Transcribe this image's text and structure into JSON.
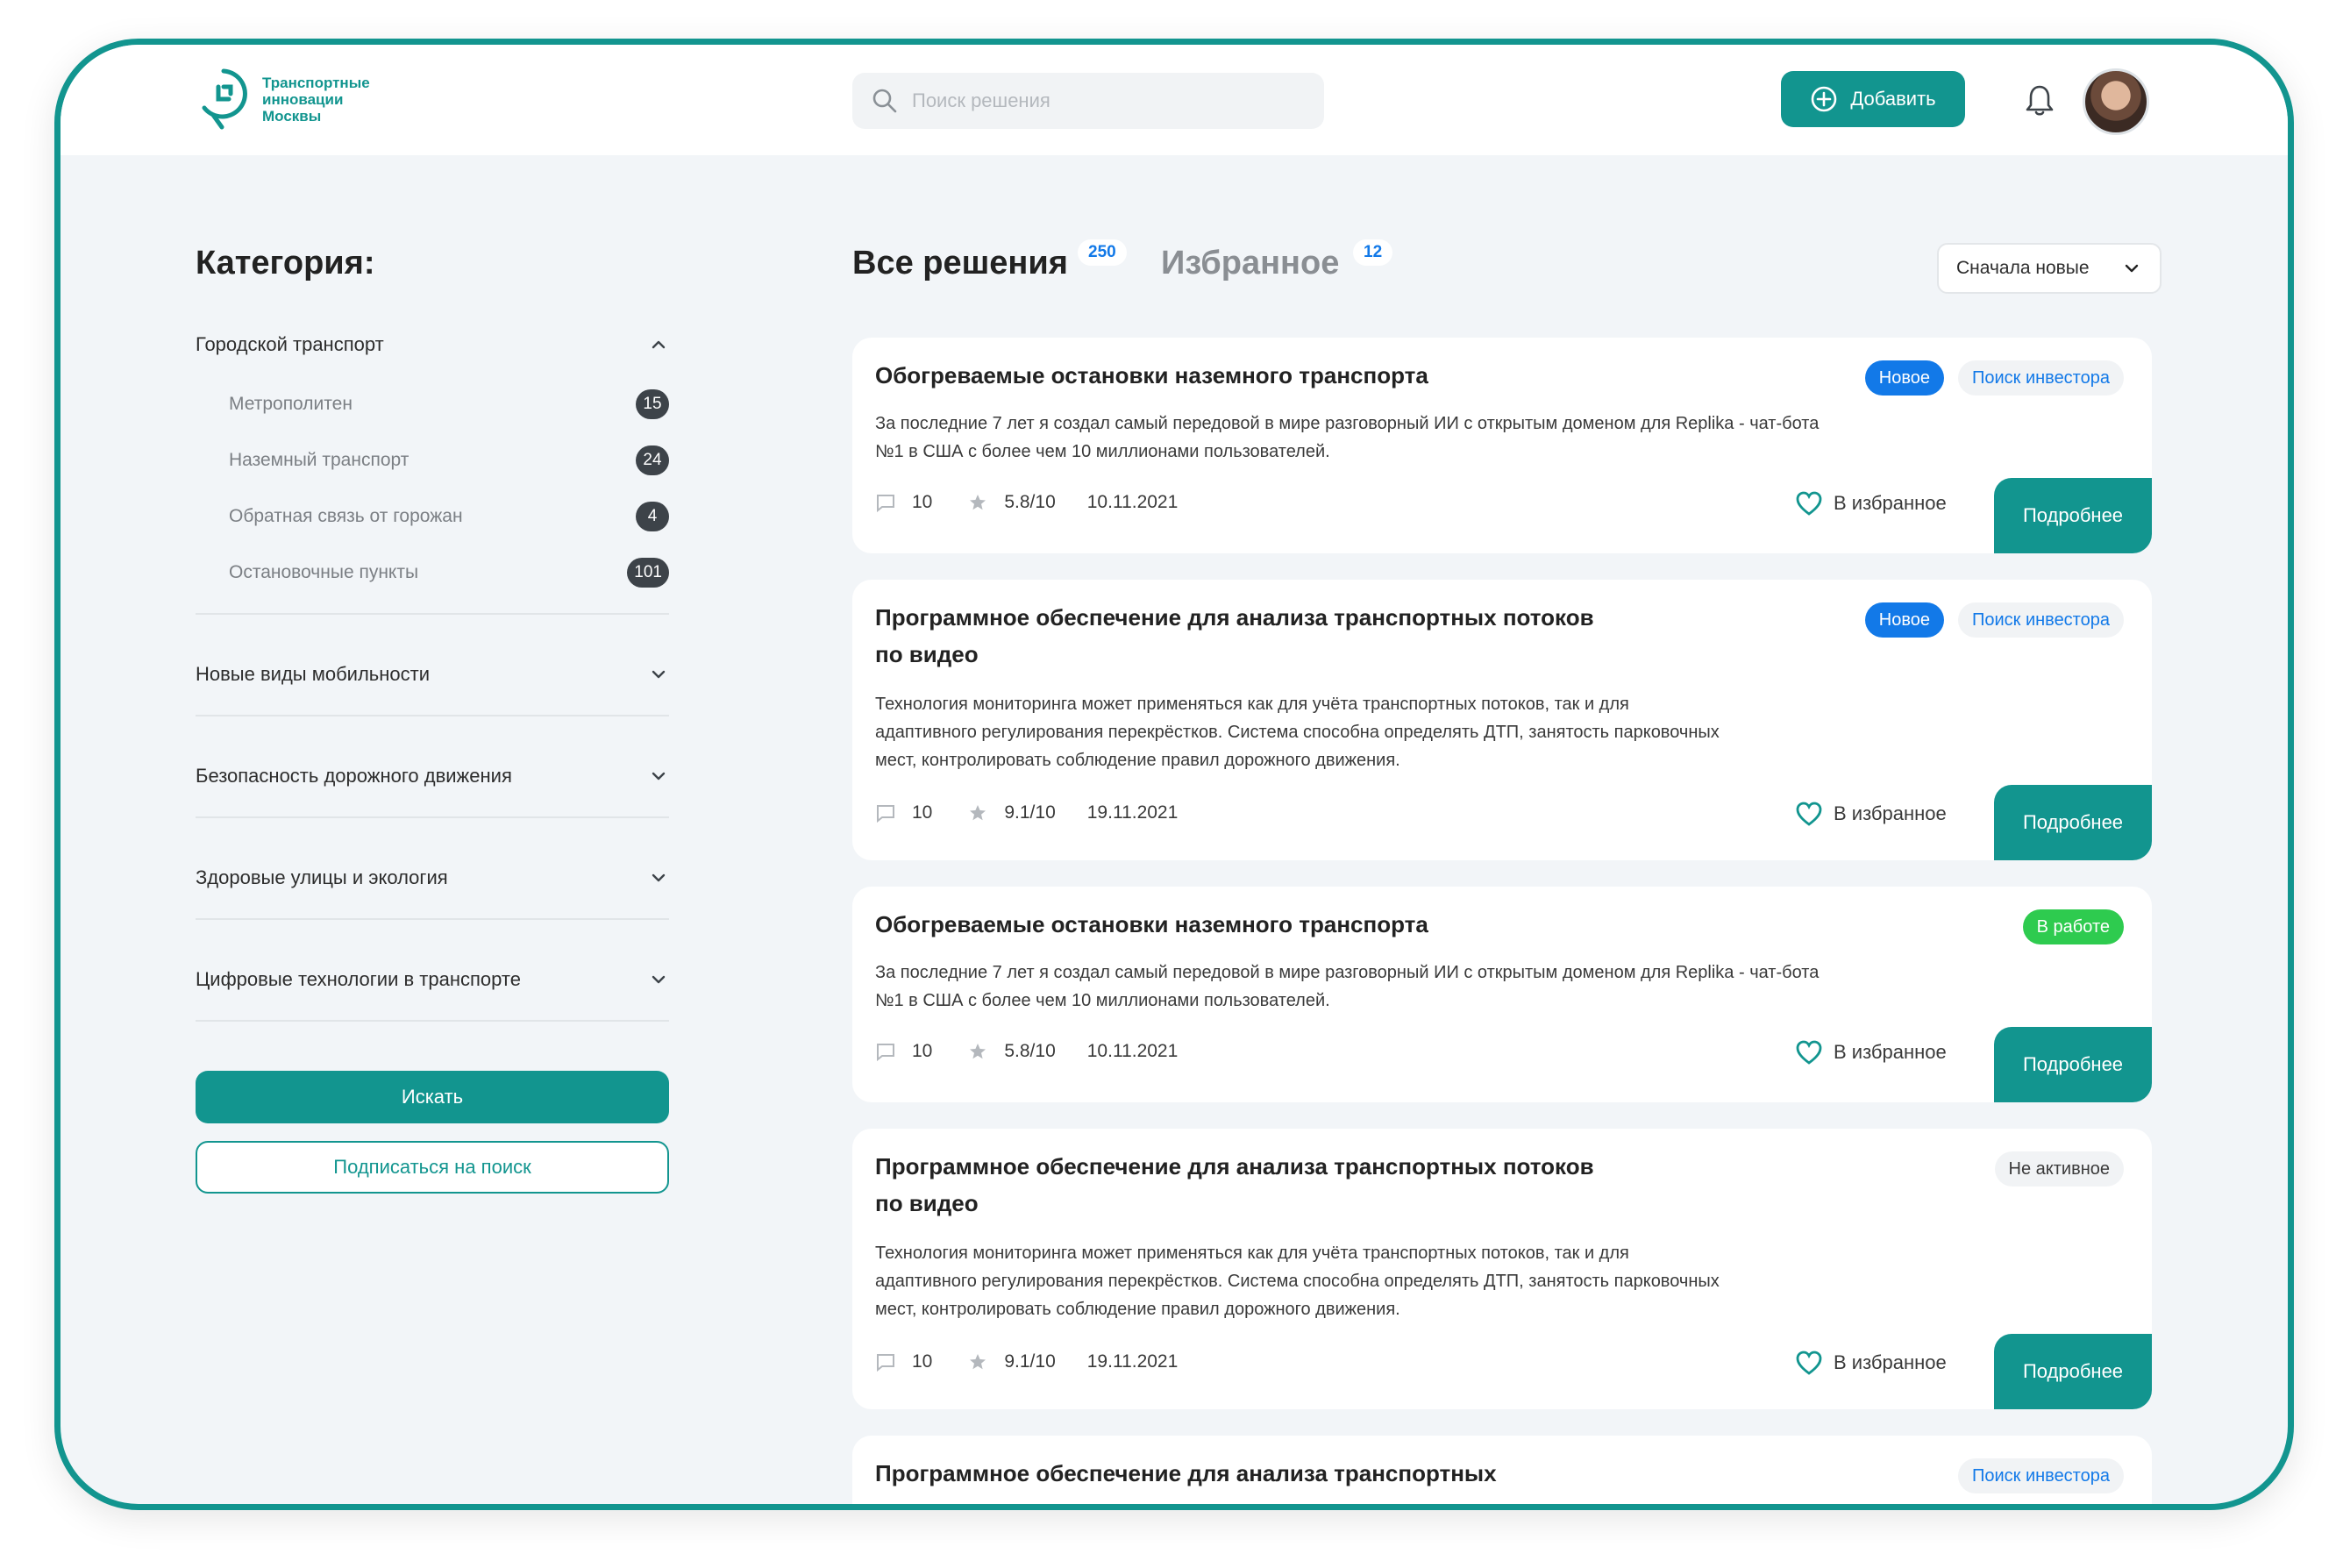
{
  "brand": {
    "name_line1": "Транспортные",
    "name_line2": "инновации",
    "name_line3": "Москвы",
    "accent": "#12958f"
  },
  "header": {
    "search_placeholder": "Поиск решения",
    "add_label": "Добавить"
  },
  "sidebar": {
    "title": "Категория:",
    "groups": [
      {
        "label": "Городской транспорт",
        "expanded": true,
        "items": [
          {
            "label": "Метрополитен",
            "count": "15"
          },
          {
            "label": "Наземный транспорт",
            "count": "24"
          },
          {
            "label": "Обратная связь от горожан",
            "count": "4"
          },
          {
            "label": "Остановочные пункты",
            "count": "101"
          }
        ]
      },
      {
        "label": "Новые виды мобильности",
        "expanded": false
      },
      {
        "label": "Безопасность дорожного движения",
        "expanded": false
      },
      {
        "label": "Здоровые улицы и экология",
        "expanded": false
      },
      {
        "label": "Цифровые технологии в транспорте",
        "expanded": false
      }
    ],
    "search_button": "Искать",
    "subscribe_button": "Подписаться на поиск"
  },
  "main": {
    "tabs": [
      {
        "label": "Все решения",
        "count": "250",
        "active": true
      },
      {
        "label": "Избранное",
        "count": "12",
        "active": false
      }
    ],
    "sort_label": "Сначала новые",
    "fav_label": "В избранное",
    "more_label": "Подробнее",
    "cards": [
      {
        "title": "Обогреваемые остановки наземного транспорта",
        "description": "За последние 7 лет я создал самый передовой в мире разговорный ИИ с открытым доменом для Replika - чат-бота №1 в США с более чем 10 миллионами пользователей.",
        "badges": [
          "Новое",
          "Поиск инвестора"
        ],
        "comments": "10",
        "rating": "5.8/10",
        "date": "10.11.2021"
      },
      {
        "title": "Программное обеспечение для анализа транспортных потоков по видео",
        "description": "Технология мониторинга может применяться как для учёта транспортных потоков, так и для адаптивного регулирования перекрёстков. Система способна определять ДТП, занятость парковочных мест, контролировать соблюдение правил дорожного движения.",
        "badges": [
          "Новое",
          "Поиск инвестора"
        ],
        "comments": "10",
        "rating": "9.1/10",
        "date": "19.11.2021"
      },
      {
        "title": "Обогреваемые остановки наземного транспорта",
        "description": "За последние 7 лет я создал самый передовой в мире разговорный ИИ с открытым доменом для Replika - чат-бота №1 в США с более чем 10 миллионами пользователей.",
        "badges": [
          "В работе"
        ],
        "comments": "10",
        "rating": "5.8/10",
        "date": "10.11.2021"
      },
      {
        "title": "Программное обеспечение для анализа транспортных потоков по видео",
        "description": "Технология мониторинга может применяться как для учёта транспортных потоков, так и для адаптивного регулирования перекрёстков. Система способна определять ДТП, занятость парковочных мест, контролировать соблюдение правил дорожного движения.",
        "badges": [
          "Не активное"
        ],
        "comments": "10",
        "rating": "9.1/10",
        "date": "19.11.2021"
      },
      {
        "title": "Программное обеспечение для анализа транспортных",
        "badges": [
          "Поиск инвестора"
        ]
      }
    ]
  }
}
